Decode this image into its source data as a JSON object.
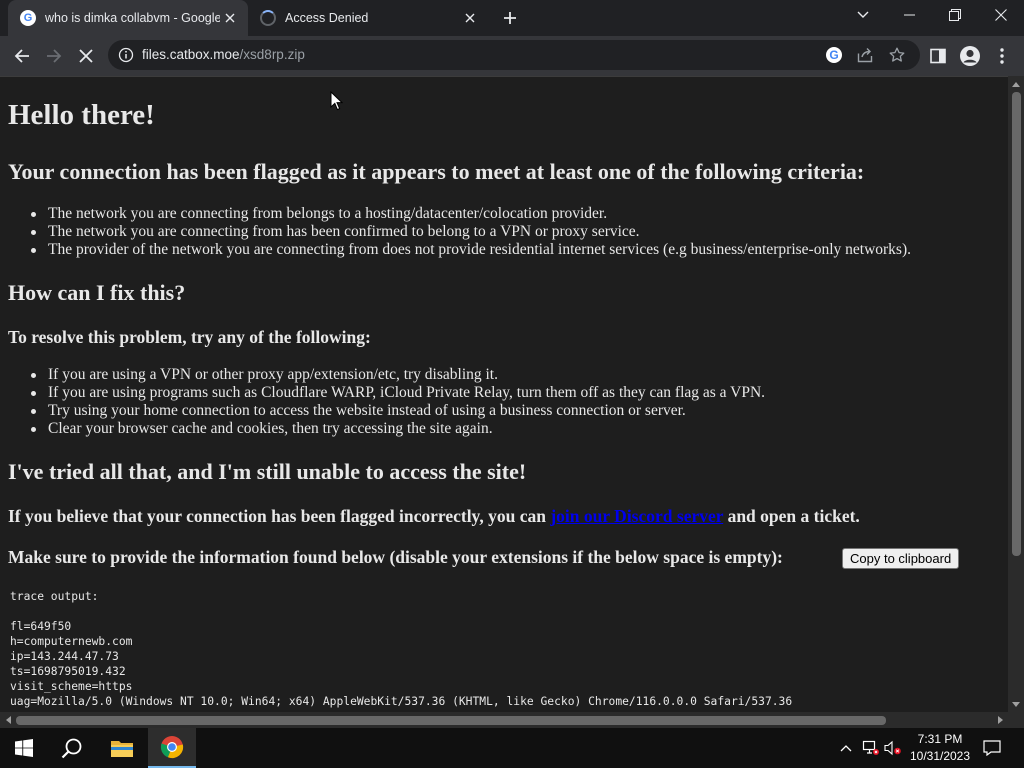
{
  "browser": {
    "tabs": [
      {
        "title": "who is dimka collabvm - Google",
        "favicon": "google-icon",
        "active": true
      },
      {
        "title": "Access Denied",
        "favicon": "loading-spinner",
        "active": false
      }
    ],
    "url_host": "files.catbox.moe",
    "url_path": "/xsd8rp.zip"
  },
  "page": {
    "heading": "Hello there!",
    "flagged_heading": "Your connection has been flagged as it appears to meet at least one of the following criteria:",
    "criteria": [
      "The network you are connecting from belongs to a hosting/datacenter/colocation provider.",
      "The network you are connecting from has been confirmed to belong to a VPN or proxy service.",
      "The provider of the network you are connecting from does not provide residential internet services (e.g business/enterprise-only networks)."
    ],
    "fix_heading": "How can I fix this?",
    "resolve_heading": "To resolve this problem, try any of the following:",
    "fixes": [
      "If you are using a VPN or other proxy app/extension/etc, try disabling it.",
      "If you are using programs such as Cloudflare WARP, iCloud Private Relay, turn them off as they can flag as a VPN.",
      "Try using your home connection to access the website instead of using a business connection or server.",
      "Clear your browser cache and cookies, then try accessing the site again."
    ],
    "tried_heading": "I've tried all that, and I'm still unable to access the site!",
    "ticket_prefix": "If you believe that your connection has been flagged incorrectly, you can ",
    "ticket_link": "join our Discord server",
    "ticket_suffix": " and open a ticket.",
    "info_heading": "Make sure to provide the information found below (disable your extensions if the below space is empty):",
    "copy_button": "Copy to clipboard",
    "trace_output": "trace output:\n\nfl=649f50\nh=computernewb.com\nip=143.244.47.73\nts=1698795019.432\nvisit_scheme=https\nuag=Mozilla/5.0 (Windows NT 10.0; Win64; x64) AppleWebKit/537.36 (KHTML, like Gecko) Chrome/116.0.0.0 Safari/537.36"
  },
  "taskbar": {
    "time": "7:31 PM",
    "date": "10/31/2023"
  }
}
